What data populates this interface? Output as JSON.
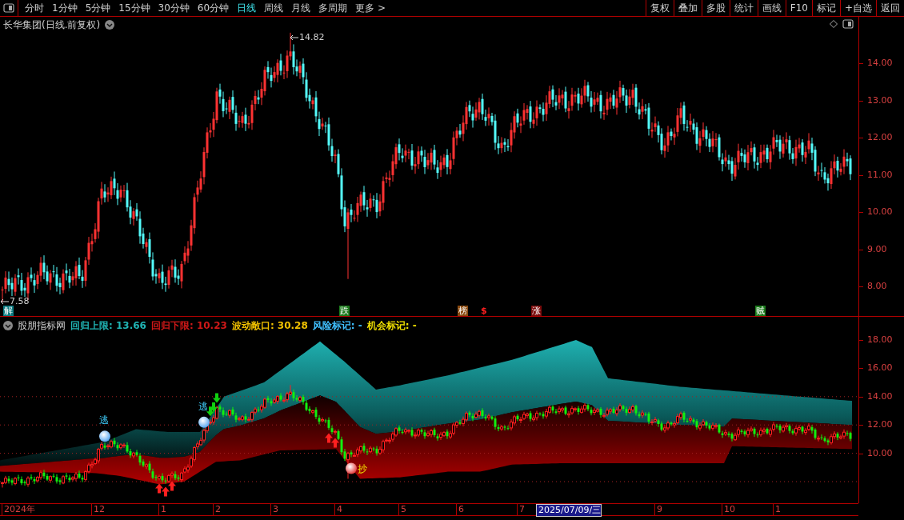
{
  "toolbar": {
    "items": [
      {
        "label": "分时",
        "selected": false
      },
      {
        "label": "1分钟",
        "selected": false
      },
      {
        "label": "5分钟",
        "selected": false
      },
      {
        "label": "15分钟",
        "selected": false
      },
      {
        "label": "30分钟",
        "selected": false
      },
      {
        "label": "60分钟",
        "selected": false
      },
      {
        "label": "日线",
        "selected": true
      },
      {
        "label": "周线",
        "selected": false
      },
      {
        "label": "月线",
        "selected": false
      },
      {
        "label": "多周期",
        "selected": false
      },
      {
        "label": "更多 >",
        "selected": false
      }
    ],
    "buttons": [
      "复权",
      "叠加",
      "多股",
      "统计",
      "画线",
      "F10",
      "标记",
      "+自选",
      "返回"
    ]
  },
  "main_chart": {
    "title": "长华集团(日线.前复权)",
    "axis_labels": [
      "14.00",
      "13.00",
      "12.00",
      "11.00",
      "10.00",
      "9.00",
      "8.00"
    ],
    "extremes": [
      {
        "text": "14.82",
        "kind": "high"
      },
      {
        "text": "7.58",
        "kind": "low"
      }
    ],
    "markers": [
      {
        "text": "解",
        "kind": "tag",
        "color": "#0a7a80"
      },
      {
        "text": "跌",
        "kind": "tag",
        "color": "#1d7a1d"
      },
      {
        "text": "榜",
        "kind": "tag",
        "color": "#8a4a10"
      },
      {
        "text": "$",
        "kind": "glyph",
        "color": "#ff2020"
      },
      {
        "text": "涨",
        "kind": "tag",
        "color": "#7a0a0a"
      },
      {
        "text": "贼",
        "kind": "tag",
        "color": "#1a7a1a"
      }
    ]
  },
  "indicator": {
    "name": "股朋指标网",
    "readings": [
      {
        "text": "回归上限: 13.66",
        "color": "#20b4b4"
      },
      {
        "text": "回归下限: 10.23",
        "color": "#d01818"
      },
      {
        "text": "波动敞口: 30.28",
        "color": "#f0c000"
      },
      {
        "text": "风险标记: -",
        "color": "#40c0ff"
      },
      {
        "text": "机会标记: -",
        "color": "#f0e000"
      }
    ],
    "axis_labels": [
      "18.00",
      "16.00",
      "14.00",
      "12.00",
      "10.00"
    ],
    "signals": [
      {
        "text": "逃",
        "kind": "sell"
      },
      {
        "text": "逃",
        "kind": "sell"
      },
      {
        "text": "抄",
        "kind": "buy"
      }
    ]
  },
  "time_axis": {
    "labels": [
      {
        "text": "2024年",
        "selected": false
      },
      {
        "text": "12",
        "selected": false
      },
      {
        "text": "1",
        "selected": false
      },
      {
        "text": "2",
        "selected": false
      },
      {
        "text": "3",
        "selected": false
      },
      {
        "text": "4",
        "selected": false
      },
      {
        "text": "5",
        "selected": false
      },
      {
        "text": "6",
        "selected": false
      },
      {
        "text": "7",
        "selected": false
      },
      {
        "text": "2025/07/09/三",
        "selected": true
      },
      {
        "text": "9",
        "selected": false
      },
      {
        "text": "10",
        "selected": false
      },
      {
        "text": "1",
        "selected": false
      }
    ]
  }
}
